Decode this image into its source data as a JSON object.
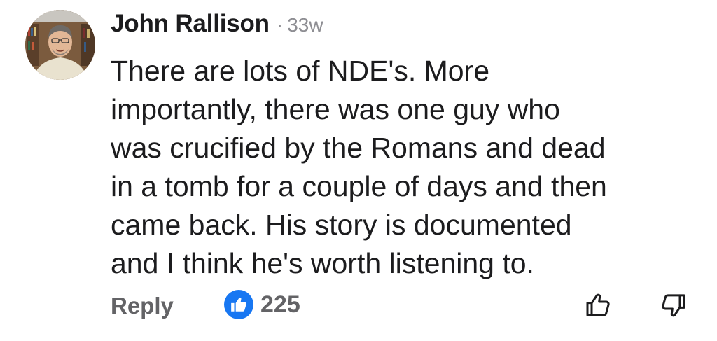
{
  "comment": {
    "author": "John Rallison",
    "separator": "·",
    "age": "33w",
    "body_lines": [
      "There are lots of NDE's. More",
      "importantly, there was one guy who",
      "was crucified by the Romans and dead",
      "in a tomb for a couple of days and then",
      "came back. His story is documented",
      "and I think he's worth listening to."
    ]
  },
  "actions": {
    "reply_label": "Reply",
    "reaction_icon": "thumbs-up-icon",
    "reaction_count": "225",
    "upvote_icon": "thumbs-up-outline-icon",
    "downvote_icon": "thumbs-down-outline-icon"
  },
  "colors": {
    "like_blue": "#1877f2",
    "muted_text": "#636366",
    "timestamp": "#8e8e93"
  }
}
